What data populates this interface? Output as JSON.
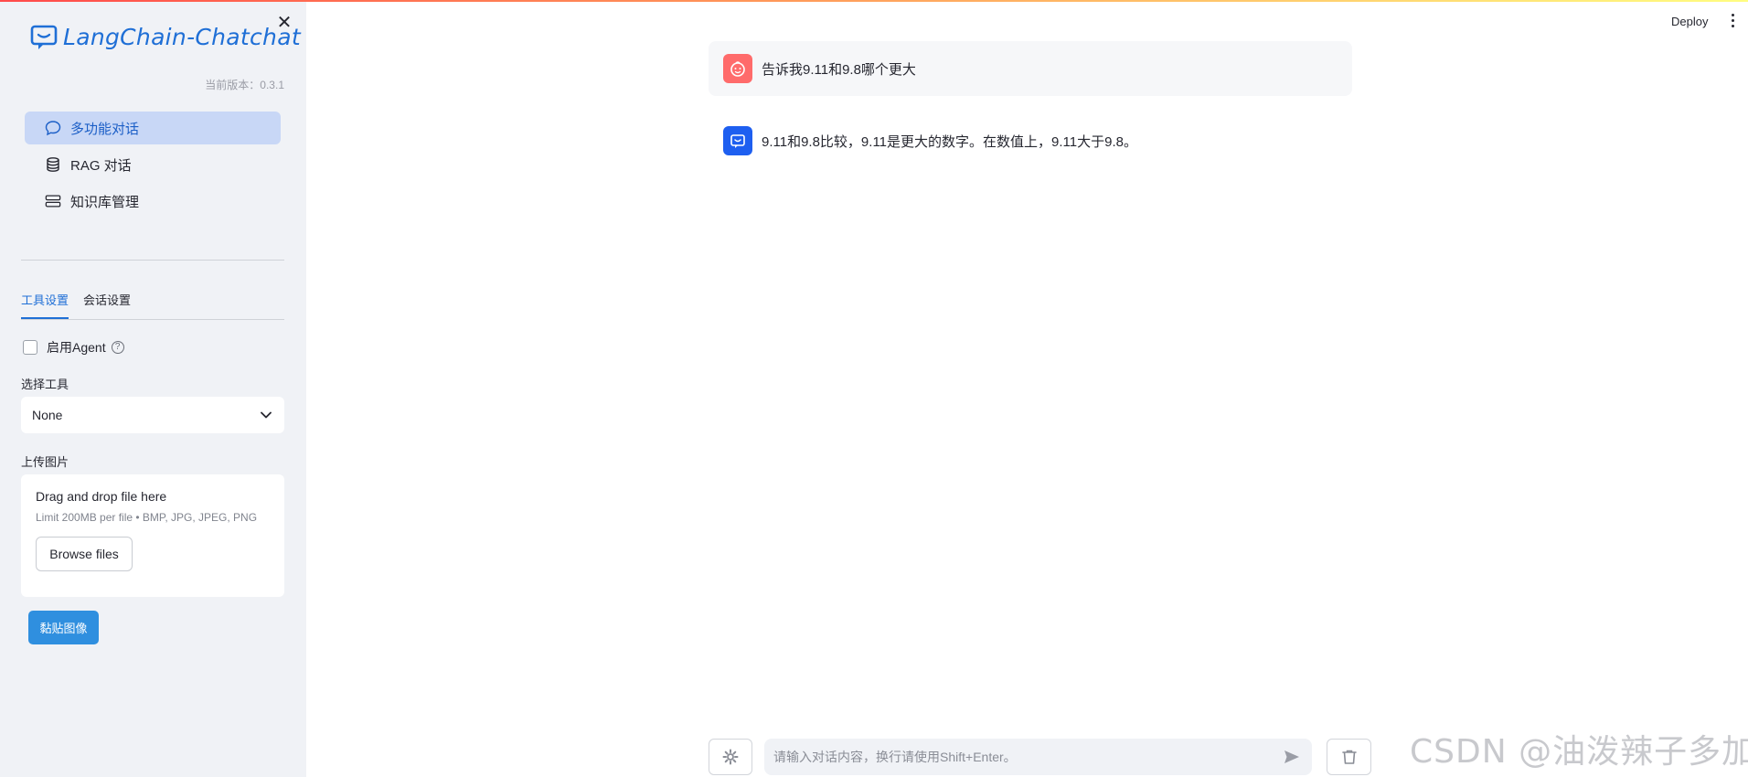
{
  "app": {
    "logo_text": "LangChain-Chatchat",
    "version": "当前版本：0.3.1",
    "close_symbol": "✕"
  },
  "sidebar": {
    "nav": [
      {
        "label": "多功能对话",
        "icon": "chat-bubble-icon",
        "active": true
      },
      {
        "label": "RAG 对话",
        "icon": "database-icon",
        "active": false
      },
      {
        "label": "知识库管理",
        "icon": "server-icon",
        "active": false
      }
    ],
    "tabs": [
      {
        "label": "工具设置",
        "active": true
      },
      {
        "label": "会话设置",
        "active": false
      }
    ],
    "agent_label": "启用Agent",
    "agent_checked": false,
    "tool_select_label": "选择工具",
    "tool_select_value": "None",
    "upload_label": "上传图片",
    "uploader": {
      "title": "Drag and drop file here",
      "limit": "Limit 200MB per file • BMP, JPG, JPEG, PNG",
      "browse_label": "Browse files"
    },
    "paste_label": "黏贴图像"
  },
  "header": {
    "deploy_label": "Deploy"
  },
  "chat": {
    "messages": [
      {
        "role": "user",
        "text": "告诉我9.11和9.8哪个更大"
      },
      {
        "role": "assistant",
        "text": "9.11和9.8比较，9.11是更大的数字。在数值上，9.11大于9.8。"
      }
    ],
    "input_placeholder": "请输入对话内容，换行请使用Shift+Enter。"
  },
  "watermark": "CSDN @油泼辣子多加",
  "colors": {
    "accent": "#1f6fd6",
    "user_avatar": "#ff6b6b",
    "ai_avatar": "#1e5ff0",
    "paste_button": "#2f8fdf"
  }
}
